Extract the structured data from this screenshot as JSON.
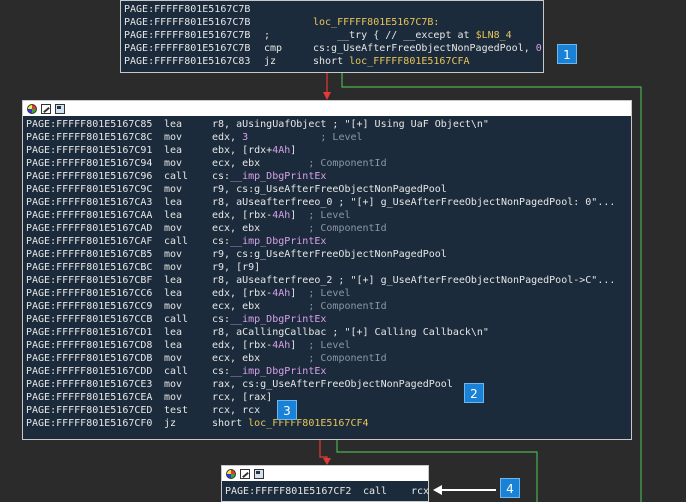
{
  "block1": {
    "lines": [
      {
        "addr": "PAGE:FFFFF801E5167C7B",
        "mn": "",
        "ops": []
      },
      {
        "addr": "PAGE:FFFFF801E5167C7B",
        "mn": "",
        "ops": [
          {
            "t": "loc_FFFFF801E5167C7B:",
            "c": "y"
          }
        ]
      },
      {
        "addr": "PAGE:FFFFF801E5167C7B",
        "mn": ";",
        "ops": [
          {
            "t": "    __try { // __except at ",
            "c": "s"
          },
          {
            "t": "$LN8_4",
            "c": "y"
          }
        ]
      },
      {
        "addr": "PAGE:FFFFF801E5167C7B",
        "mn": "cmp",
        "ops": [
          {
            "t": "cs:g_UseAfterFreeObjectNonPagedPool, ",
            "c": "s"
          },
          {
            "t": "0",
            "c": "p"
          }
        ]
      },
      {
        "addr": "PAGE:FFFFF801E5167C83",
        "mn": "jz",
        "ops": [
          {
            "t": "short ",
            "c": "s"
          },
          {
            "t": "loc_FFFFF801E5167CFA",
            "c": "y"
          }
        ]
      }
    ]
  },
  "block2": {
    "lines": [
      {
        "addr": "PAGE:FFFFF801E5167C85",
        "mn": "lea",
        "ops": [
          {
            "t": "r8, aUsingUafObject ; \"[+] Using UaF Object\\n\"",
            "c": "s"
          }
        ]
      },
      {
        "addr": "PAGE:FFFFF801E5167C8C",
        "mn": "mov",
        "ops": [
          {
            "t": "edx, ",
            "c": "s"
          },
          {
            "t": "3",
            "c": "p"
          },
          {
            "t": "            ; Level",
            "c": "c"
          }
        ]
      },
      {
        "addr": "PAGE:FFFFF801E5167C91",
        "mn": "lea",
        "ops": [
          {
            "t": "ebx, [rdx+",
            "c": "s"
          },
          {
            "t": "4Ah",
            "c": "p"
          },
          {
            "t": "]",
            "c": "s"
          }
        ]
      },
      {
        "addr": "PAGE:FFFFF801E5167C94",
        "mn": "mov",
        "ops": [
          {
            "t": "ecx, ebx",
            "c": "s"
          },
          {
            "t": "        ; ComponentId",
            "c": "c"
          }
        ]
      },
      {
        "addr": "PAGE:FFFFF801E5167C96",
        "mn": "call",
        "ops": [
          {
            "t": "cs:",
            "c": "s"
          },
          {
            "t": "__imp_DbgPrintEx",
            "c": "p"
          }
        ]
      },
      {
        "addr": "PAGE:FFFFF801E5167C9C",
        "mn": "mov",
        "ops": [
          {
            "t": "r9, cs:g_UseAfterFreeObjectNonPagedPool",
            "c": "s"
          }
        ]
      },
      {
        "addr": "PAGE:FFFFF801E5167CA3",
        "mn": "lea",
        "ops": [
          {
            "t": "r8, aUseafterfreeo_0 ; \"[+] g_UseAfterFreeObjectNonPagedPool: 0\"...",
            "c": "s"
          }
        ]
      },
      {
        "addr": "PAGE:FFFFF801E5167CAA",
        "mn": "lea",
        "ops": [
          {
            "t": "edx, [rbx-",
            "c": "s"
          },
          {
            "t": "4Ah",
            "c": "p"
          },
          {
            "t": "]",
            "c": "s"
          },
          {
            "t": "  ; Level",
            "c": "c"
          }
        ]
      },
      {
        "addr": "PAGE:FFFFF801E5167CAD",
        "mn": "mov",
        "ops": [
          {
            "t": "ecx, ebx",
            "c": "s"
          },
          {
            "t": "        ; ComponentId",
            "c": "c"
          }
        ]
      },
      {
        "addr": "PAGE:FFFFF801E5167CAF",
        "mn": "call",
        "ops": [
          {
            "t": "cs:",
            "c": "s"
          },
          {
            "t": "__imp_DbgPrintEx",
            "c": "p"
          }
        ]
      },
      {
        "addr": "PAGE:FFFFF801E5167CB5",
        "mn": "mov",
        "ops": [
          {
            "t": "r9, cs:g_UseAfterFreeObjectNonPagedPool",
            "c": "s"
          }
        ]
      },
      {
        "addr": "PAGE:FFFFF801E5167CBC",
        "mn": "mov",
        "ops": [
          {
            "t": "r9, [r9]",
            "c": "s"
          }
        ]
      },
      {
        "addr": "PAGE:FFFFF801E5167CBF",
        "mn": "lea",
        "ops": [
          {
            "t": "r8, aUseafterfreeo_2 ; \"[+] g_UseAfterFreeObjectNonPagedPool->C\"...",
            "c": "s"
          }
        ]
      },
      {
        "addr": "PAGE:FFFFF801E5167CC6",
        "mn": "lea",
        "ops": [
          {
            "t": "edx, [rbx-",
            "c": "s"
          },
          {
            "t": "4Ah",
            "c": "p"
          },
          {
            "t": "]",
            "c": "s"
          },
          {
            "t": "  ; Level",
            "c": "c"
          }
        ]
      },
      {
        "addr": "PAGE:FFFFF801E5167CC9",
        "mn": "mov",
        "ops": [
          {
            "t": "ecx, ebx",
            "c": "s"
          },
          {
            "t": "        ; ComponentId",
            "c": "c"
          }
        ]
      },
      {
        "addr": "PAGE:FFFFF801E5167CCB",
        "mn": "call",
        "ops": [
          {
            "t": "cs:",
            "c": "s"
          },
          {
            "t": "__imp_DbgPrintEx",
            "c": "p"
          }
        ]
      },
      {
        "addr": "PAGE:FFFFF801E5167CD1",
        "mn": "lea",
        "ops": [
          {
            "t": "r8, aCallingCallbac ; \"[+] Calling Callback\\n\"",
            "c": "s"
          }
        ]
      },
      {
        "addr": "PAGE:FFFFF801E5167CD8",
        "mn": "lea",
        "ops": [
          {
            "t": "edx, [rbx-",
            "c": "s"
          },
          {
            "t": "4Ah",
            "c": "p"
          },
          {
            "t": "]",
            "c": "s"
          },
          {
            "t": "  ; Level",
            "c": "c"
          }
        ]
      },
      {
        "addr": "PAGE:FFFFF801E5167CDB",
        "mn": "mov",
        "ops": [
          {
            "t": "ecx, ebx",
            "c": "s"
          },
          {
            "t": "        ; ComponentId",
            "c": "c"
          }
        ]
      },
      {
        "addr": "PAGE:FFFFF801E5167CDD",
        "mn": "call",
        "ops": [
          {
            "t": "cs:",
            "c": "s"
          },
          {
            "t": "__imp_DbgPrintEx",
            "c": "p"
          }
        ]
      },
      {
        "addr": "PAGE:FFFFF801E5167CE3",
        "mn": "mov",
        "ops": [
          {
            "t": "rax, cs:g_UseAfterFreeObjectNonPagedPool",
            "c": "s"
          }
        ]
      },
      {
        "addr": "PAGE:FFFFF801E5167CEA",
        "mn": "mov",
        "ops": [
          {
            "t": "rcx, [rax]",
            "c": "s"
          }
        ]
      },
      {
        "addr": "PAGE:FFFFF801E5167CED",
        "mn": "test",
        "ops": [
          {
            "t": "rcx, rcx",
            "c": "s"
          }
        ]
      },
      {
        "addr": "PAGE:FFFFF801E5167CF0",
        "mn": "jz",
        "ops": [
          {
            "t": "short ",
            "c": "s"
          },
          {
            "t": "loc_FFFFF801E5167CF4",
            "c": "y"
          }
        ]
      }
    ]
  },
  "block3": {
    "lines": [
      {
        "addr": "PAGE:FFFFF801E5167CF2",
        "mn": "call",
        "ops": [
          {
            "t": "rcx",
            "c": "s"
          }
        ]
      }
    ]
  },
  "badges": [
    "1",
    "2",
    "3",
    "4"
  ],
  "colors": {
    "background": "#2b2b2b",
    "block_bg": "#1b2b3b",
    "label": "#e8c55a",
    "number": "#d7a0e8",
    "comment": "#8a96a8",
    "edge_taken": "#4caf50",
    "edge_not_taken": "#e53935",
    "badge": "#1a82d6"
  }
}
